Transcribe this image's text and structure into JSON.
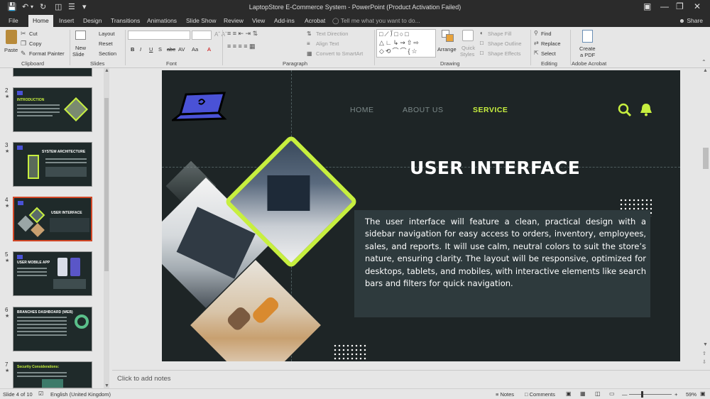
{
  "window": {
    "title": "LaptopStore E-Commerce System - PowerPoint (Product Activation Failed)"
  },
  "tabs": [
    {
      "label": "File"
    },
    {
      "label": "Home"
    },
    {
      "label": "Insert"
    },
    {
      "label": "Design"
    },
    {
      "label": "Transitions"
    },
    {
      "label": "Animations"
    },
    {
      "label": "Slide Show"
    },
    {
      "label": "Review"
    },
    {
      "label": "View"
    },
    {
      "label": "Add-ins"
    },
    {
      "label": "Acrobat"
    }
  ],
  "tell_me": "Tell me what you want to do...",
  "share": "Share",
  "ribbon": {
    "clipboard": {
      "paste": "Paste",
      "cut": "Cut",
      "copy": "Copy",
      "format_painter": "Format Painter",
      "label": "Clipboard"
    },
    "slides": {
      "new_slide": "New",
      "new_slide2": "Slide",
      "layout": "Layout",
      "reset": "Reset",
      "section": "Section",
      "label": "Slides"
    },
    "font": {
      "label": "Font",
      "bold": "B",
      "italic": "I",
      "underline": "U",
      "shadow": "S",
      "strike": "abc",
      "spacing": "AV",
      "case": "Aa",
      "clear": "A"
    },
    "paragraph": {
      "text_direction": "Text Direction",
      "align_text": "Align Text",
      "convert_smartart": "Convert to SmartArt",
      "label": "Paragraph"
    },
    "drawing": {
      "arrange": "Arrange",
      "quick_styles": "Quick",
      "quick_styles2": "Styles",
      "shape_fill": "Shape Fill",
      "shape_outline": "Shape Outline",
      "shape_effects": "Shape Effects",
      "label": "Drawing"
    },
    "editing": {
      "find": "Find",
      "replace": "Replace",
      "select": "Select",
      "label": "Editing"
    },
    "acrobat": {
      "create_pdf": "Create",
      "create_pdf2": "a PDF",
      "label": "Adobe Acrobat"
    }
  },
  "thumbnails": [
    {
      "num": "2",
      "title": "INTRODUCTION"
    },
    {
      "num": "3",
      "title": "SYSTEM ARCHITECTURE"
    },
    {
      "num": "4",
      "title": "USER INTERFACE"
    },
    {
      "num": "5",
      "title": "USER MOBILE APP"
    },
    {
      "num": "6",
      "title": "BRANCHES DASHBOARD (WEB)"
    },
    {
      "num": "7",
      "title": "Security Considerations:"
    }
  ],
  "slide": {
    "nav": [
      "HOME",
      "ABOUT US",
      "SERVICE"
    ],
    "title": "USER INTERFACE",
    "body": "The user interface will feature a clean, practical design with a sidebar navigation for easy access to orders, inventory, employees, sales, and reports. It will use calm, neutral colors to suit the store’s nature, ensuring clarity. The layout will be responsive, optimized for desktops, tablets, and mobiles, with interactive elements like search bars and filters for quick navigation.",
    "accent_color": "#c7ef3f",
    "background_color": "#1e2526"
  },
  "notes_placeholder": "Click to add notes",
  "status": {
    "slide": "Slide 4 of 10",
    "language": "English (United Kingdom)",
    "notes": "Notes",
    "comments": "Comments",
    "zoom": "59%"
  }
}
